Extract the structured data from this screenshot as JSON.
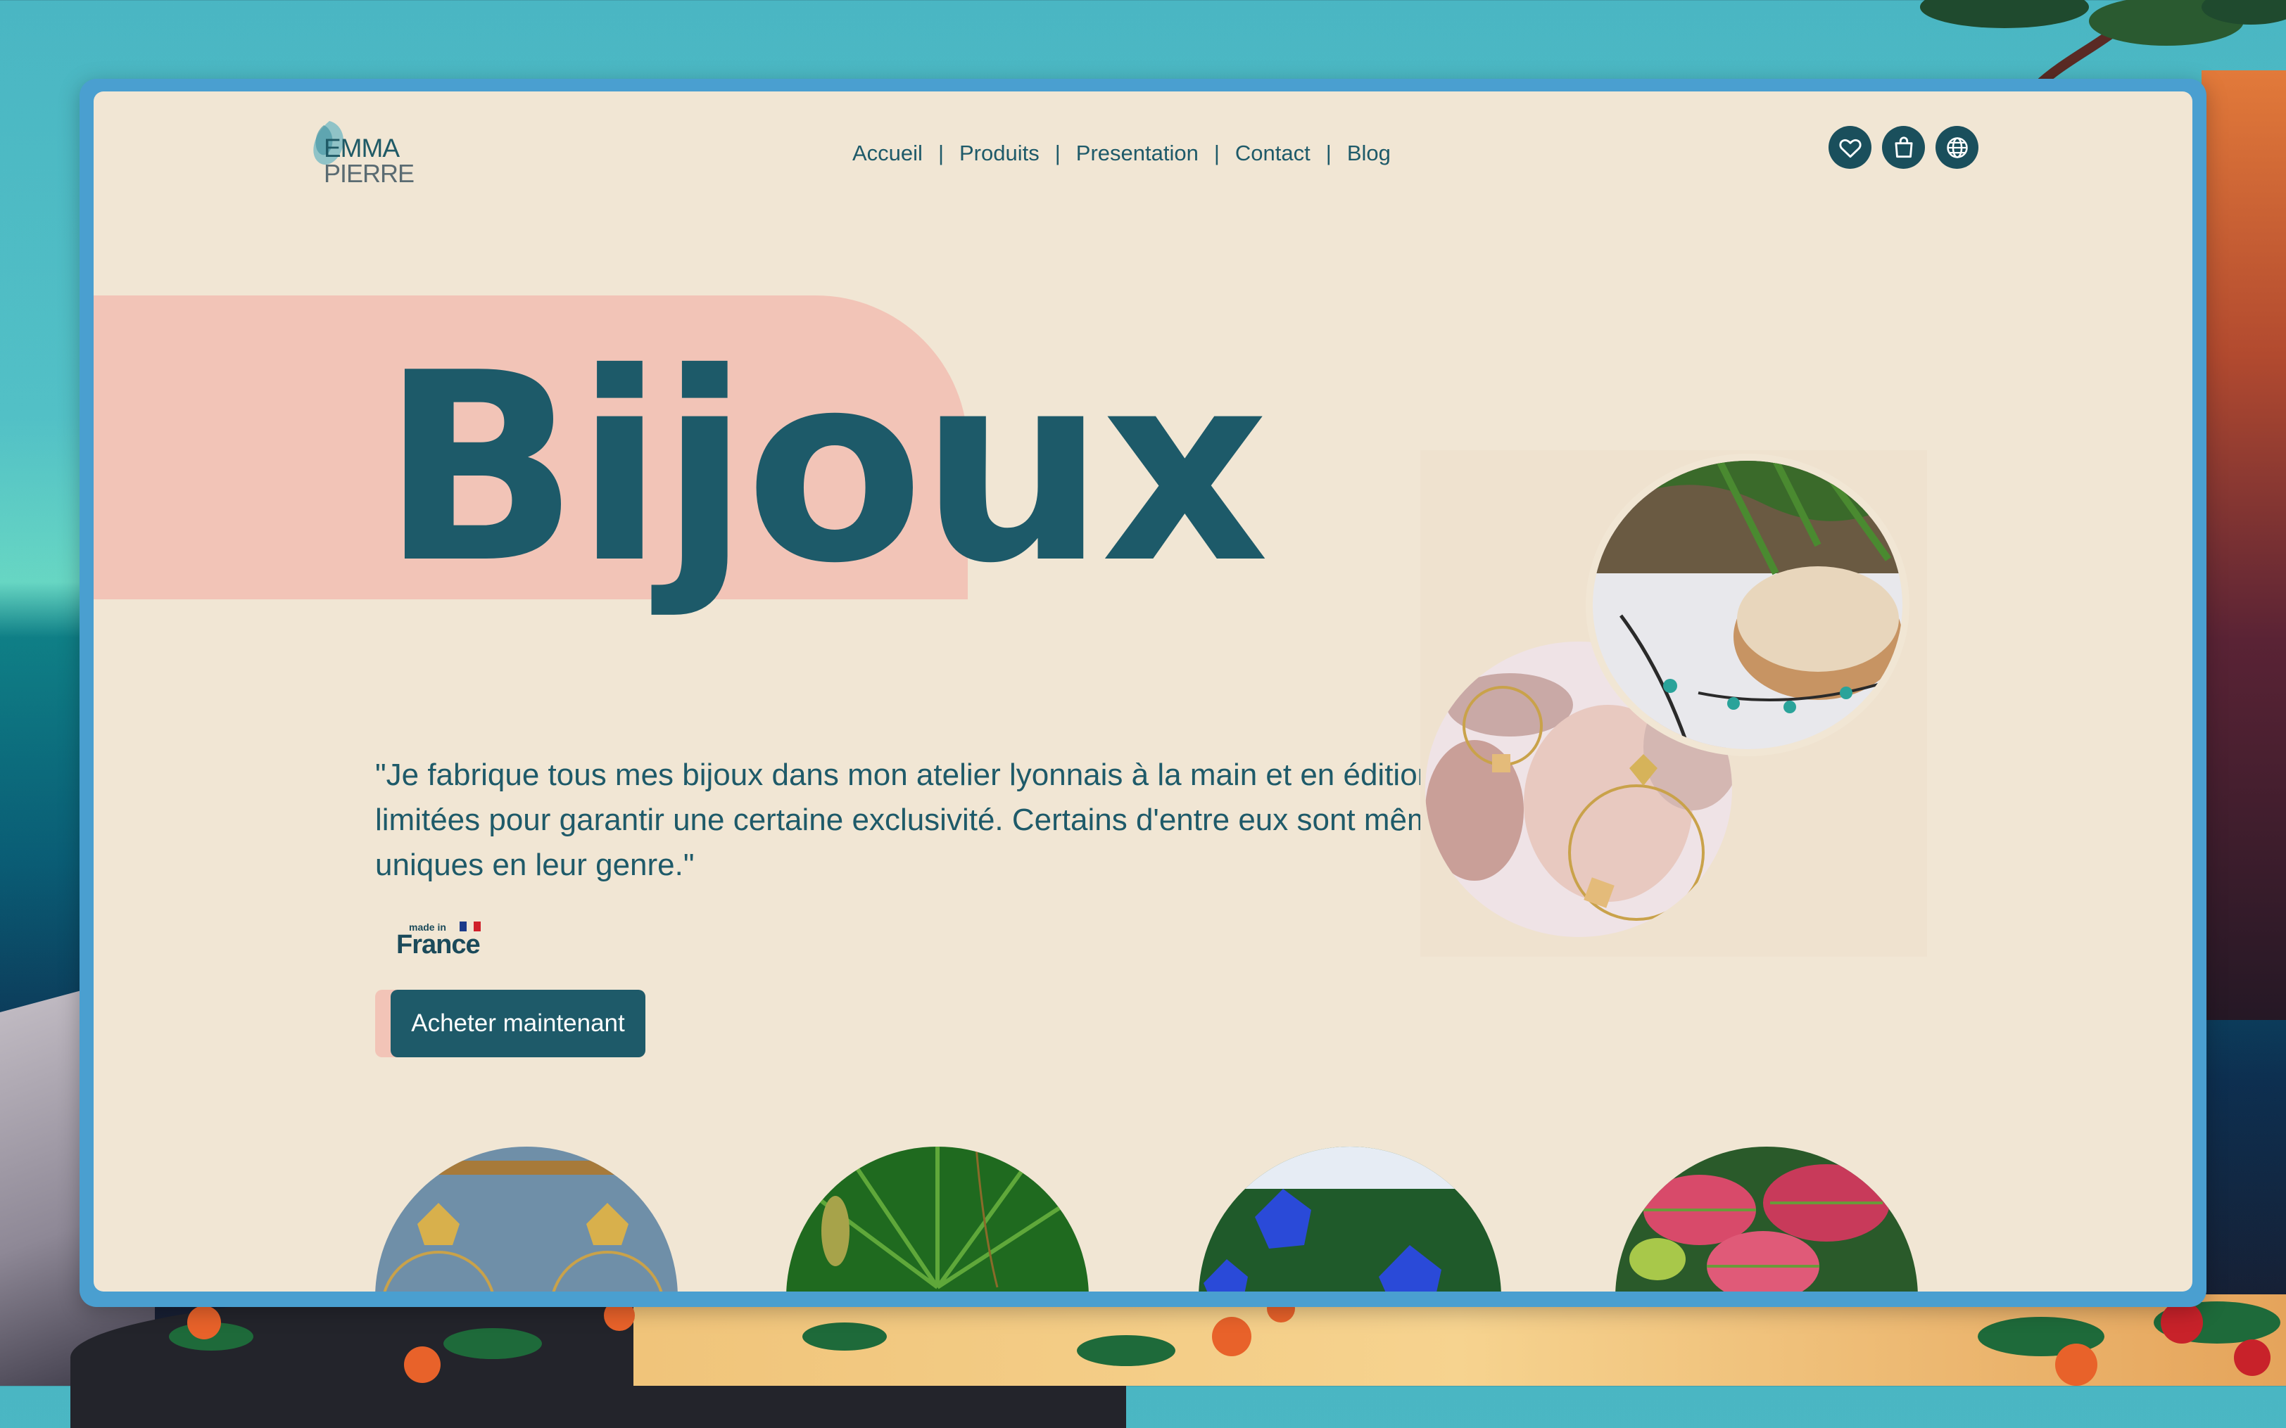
{
  "brand": {
    "logo_line1": "EMMA",
    "logo_line2": "PIERRE"
  },
  "nav": {
    "items": [
      {
        "label": "Accueil"
      },
      {
        "label": "Produits"
      },
      {
        "label": "Presentation"
      },
      {
        "label": "Contact"
      },
      {
        "label": "Blog"
      }
    ],
    "separator": "|"
  },
  "header_icons": [
    "heart-icon",
    "shopping-bag-icon",
    "globe-icon"
  ],
  "hero": {
    "title": "Bijoux",
    "quote": "\"Je fabrique tous mes bijoux dans mon atelier lyonnais à la main et en éditions limitées pour garantir une certaine exclusivité. Certains d'entre eux sont même uniques en leur genre.\"",
    "badge_small": "made in",
    "badge_big": "France",
    "cta_label": "Acheter maintenant"
  },
  "colors": {
    "page_bg": "#f1e6d4",
    "primary_teal": "#1e5a69",
    "accent_pink": "#f2c4b7",
    "window_frame": "#4a9fd0"
  }
}
